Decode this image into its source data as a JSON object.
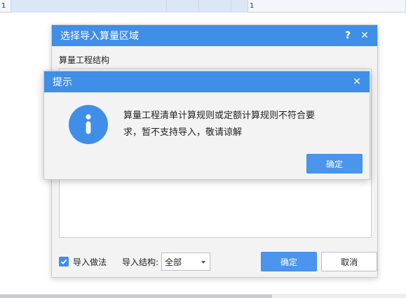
{
  "background": {
    "cells": [
      "1",
      "",
      "",
      "",
      "",
      "1",
      ""
    ]
  },
  "import_dialog": {
    "title": "选择导入算量区域",
    "help_icon": "?",
    "close_icon": "✕",
    "structure_label": "算量工程结构",
    "import_method_label": "导入做法",
    "import_method_checked": true,
    "import_structure_label": "导入结构:",
    "import_structure_value": "全部",
    "ok_label": "确定",
    "cancel_label": "取消"
  },
  "prompt_dialog": {
    "title": "提示",
    "close_icon": "✕",
    "icon": "info-icon",
    "message_line1": "算量工程清单计算规则或定额计算规则不符合要",
    "message_line2": "求，暂不支持导入，敬请谅解",
    "ok_label": "确定"
  },
  "colors": {
    "accent": "#3f8ee8",
    "button_primary": "#4b95ec"
  }
}
